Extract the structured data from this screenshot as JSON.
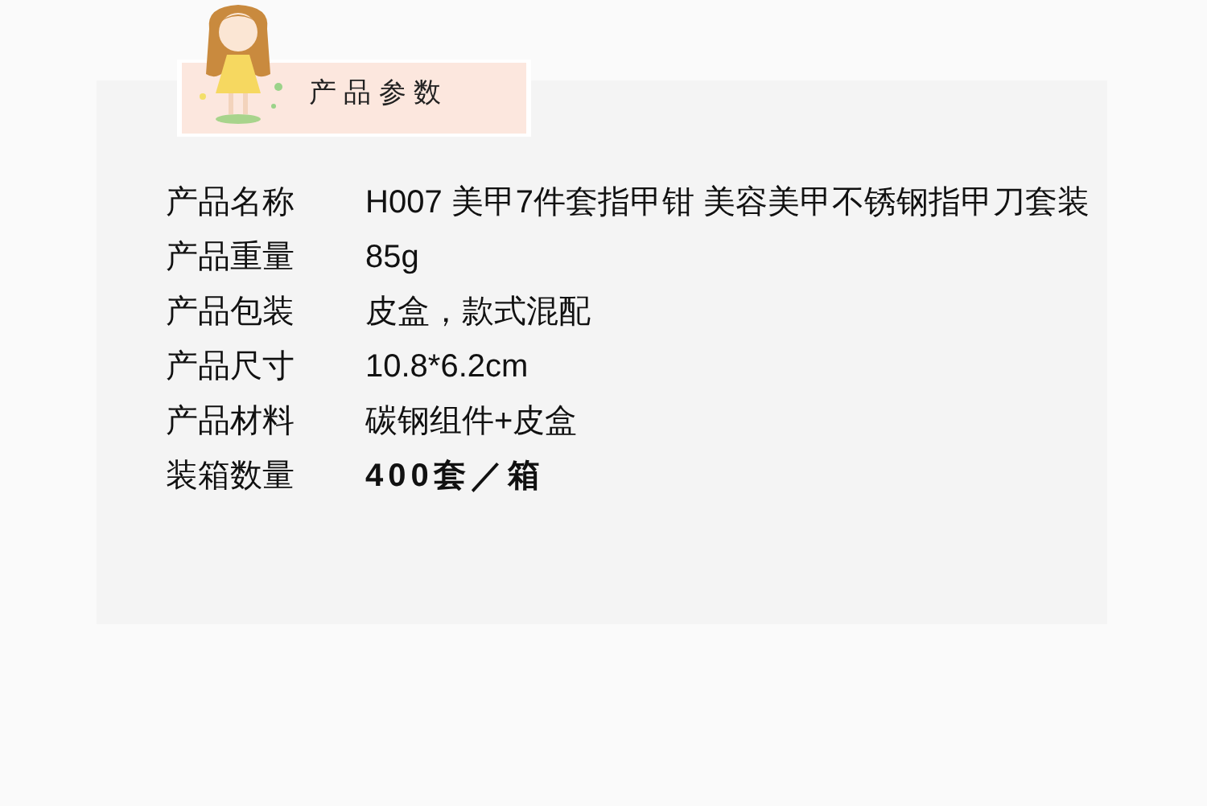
{
  "header": {
    "title": "产 品 参 数"
  },
  "specs": [
    {
      "label": "产品名称",
      "value": "H007 美甲7件套指甲钳 美容美甲不锈钢指甲刀套装",
      "bold": false
    },
    {
      "label": "产品重量",
      "value": "85g",
      "bold": false
    },
    {
      "label": "产品包装",
      "value": "皮盒，款式混配",
      "bold": false
    },
    {
      "label": "产品尺寸",
      "value": "10.8*6.2cm",
      "bold": false
    },
    {
      "label": "产品材料",
      "value": "碳钢组件+皮盒",
      "bold": false
    },
    {
      "label": "装箱数量",
      "value": "400套／箱",
      "bold": true
    }
  ]
}
